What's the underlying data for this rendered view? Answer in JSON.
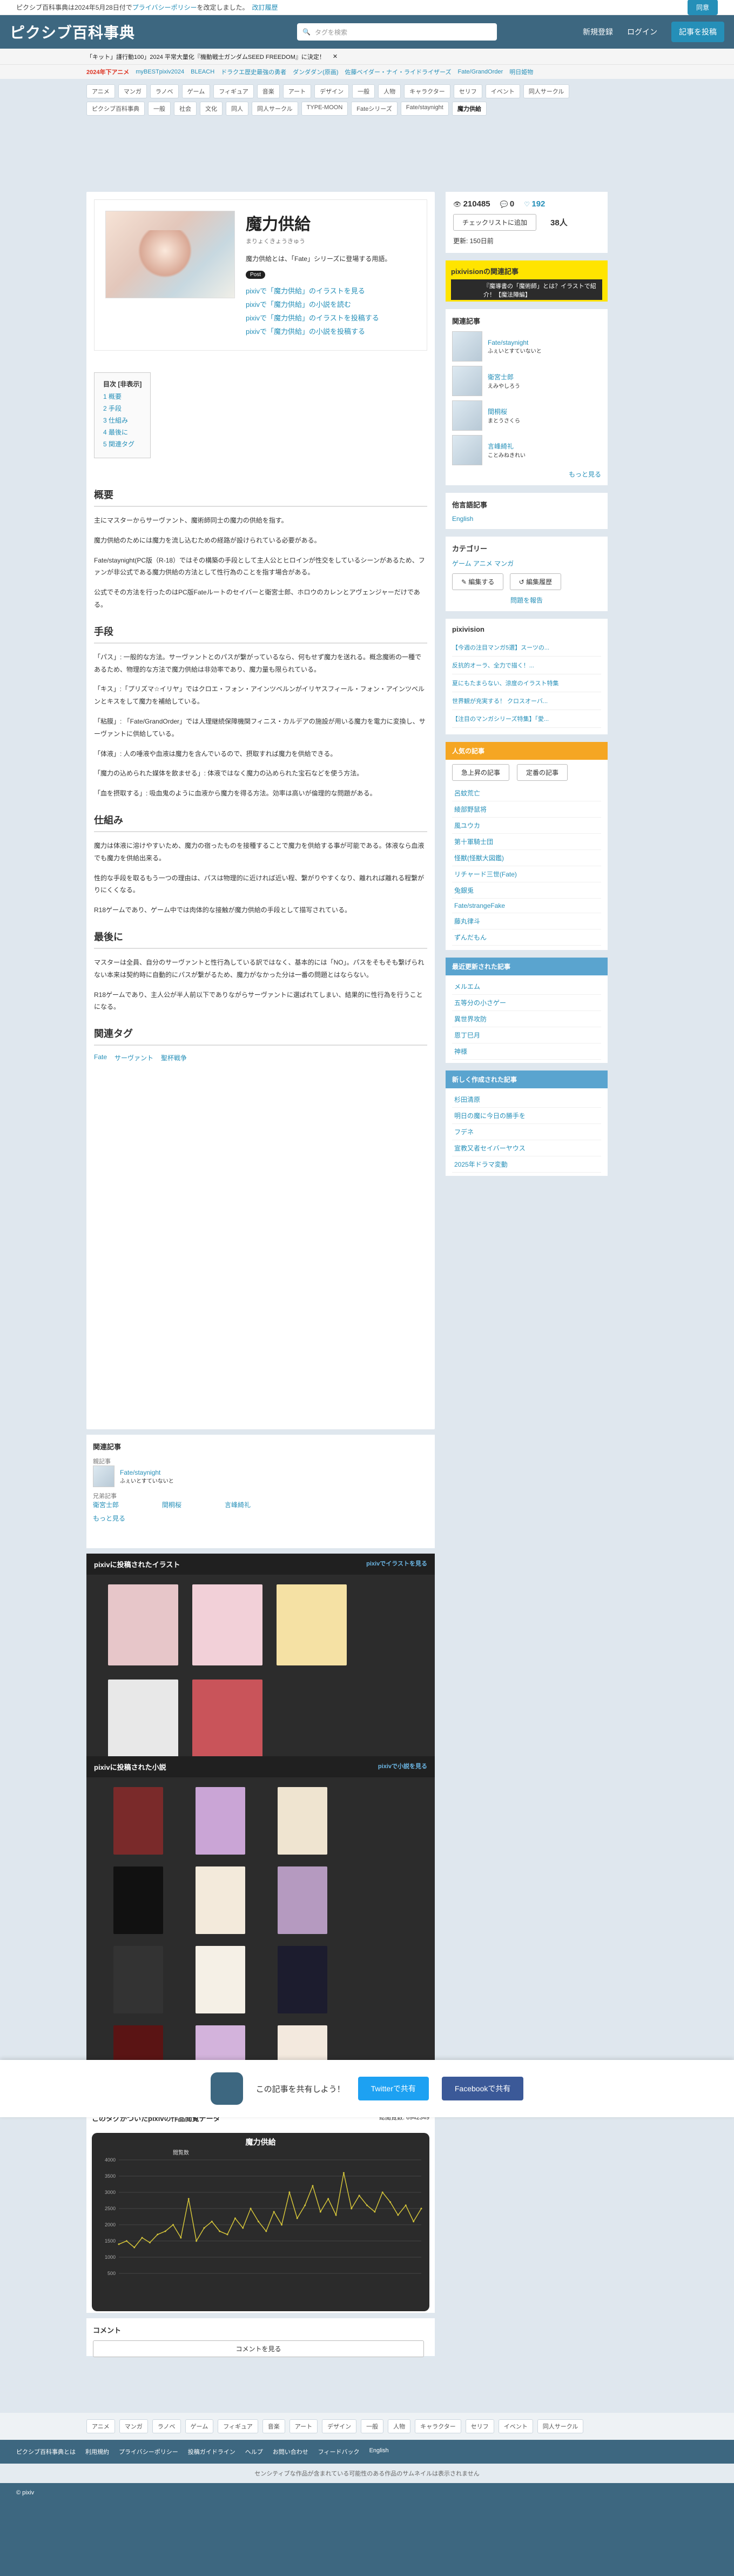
{
  "notice": {
    "text": "ピクシブ百科事典は2024年5月28日付で",
    "link": "プライバシーポリシー",
    "text2": "を改定しました。",
    "link2": "改訂履歴",
    "button": "同意"
  },
  "header": {
    "logo": "ピクシブ百科事典",
    "search_placeholder": "タグを検索",
    "new_register": "新規登録",
    "login": "ログイン",
    "write_button": "記事を投稿"
  },
  "trending": [
    "「キット」謹行動100」2024 平常大量化『機動戦士ガンダムSEED FREEDOM』に決定！"
  ],
  "trending2": {
    "label": "2024年下アニメ",
    "items": [
      "myBESTpixiv2024",
      "BLEACH",
      "ドラクエ歴史最強の勇者",
      "ダンダダン(原画)",
      "佐藤ベイダー・ナイ・ライドライザーズ",
      "Fate/GrandOrder",
      "明日姫物"
    ]
  },
  "cats1": [
    "アニメ",
    "マンガ",
    "ラノベ",
    "ゲーム",
    "フィギュア",
    "音楽",
    "アート",
    "デザイン",
    "一般",
    "人物",
    "キャラクター",
    "セリフ",
    "イベント",
    "同人サークル"
  ],
  "cats2": [
    "ピクシブ百科事典",
    "一般",
    "社会",
    "文化",
    "同人",
    "同人サークル",
    "TYPE-MOON",
    "Fateシリーズ",
    "Fate/staynight",
    "魔力供給"
  ],
  "article": {
    "title": "魔力供給",
    "reading": "まりょくきょうきゅう",
    "desc": "魔力供給とは、「Fate」シリーズに登場する用語。",
    "post": "Post",
    "links": [
      "pixivで「魔力供給」のイラストを見る",
      "pixivで「魔力供給」の小説を読む",
      "pixivで「魔力供給」のイラストを投稿する",
      "pixivで「魔力供給」の小説を投稿する"
    ],
    "toc_title": "目次 [非表示]",
    "toc": [
      "1 概要",
      "2 手段",
      "3 仕組み",
      "4 最後に",
      "5 関連タグ"
    ],
    "sections": [
      {
        "h": "概要",
        "p": [
          "主にマスターからサーヴァント、魔術師同士の魔力の供給を指す。",
          "魔力供給のためには魔力を流し込むための経路が設けられている必要がある。",
          "Fate/staynight(PC版（R-18）ではその構築の手段として主人公とヒロインが性交をしているシーンがあるため、ファンが非公式である魔力供給の方法として性行為のことを指す場合がある。",
          "公式でその方法を行ったのはPC版Fateルートのセイバーと衛宮士郎、ホロウのカレンとアヴェンジャーだけである。"
        ]
      },
      {
        "h": "手段",
        "p": [
          "「パス」: 一般的な方法。サーヴァントとのパスが繋がっているなら、何もせず魔力を送れる。概念魔術の一種であるため、物理的な方法で魔力供給は非効率であり、魔力量も限られている。",
          "「キス」:「プリズマ☆イリヤ」ではクロエ・フォン・アインツベルンがイリヤスフィール・フォン・アインツベルンとキスをして魔力を補給している。",
          "「粘膜」: 「Fate/GrandOrder」では人理継続保障機関フィニス・カルデアの施設が用いる魔力を電力に変換し、サーヴァントに供給している。",
          "「体液」: 人の唾液や血液は魔力を含んでいるので、摂取すれば魔力を供給できる。",
          "「魔力の込められた媒体を飲ませる」: 体液ではなく魔力の込められた宝石などを使う方法。",
          "「血を摂取する」: 吸血鬼のように血液から魔力を得る方法。効率は高いが倫理的な問題がある。"
        ]
      },
      {
        "h": "仕組み",
        "p": [
          "魔力は体液に溶けやすいため、魔力の宿ったものを接種することで魔力を供給する事が可能である。体液なら血液でも魔力を供給出来る。",
          "性的な手段を取るもう一つの理由は、パスは物理的に近ければ近い程、繋がりやすくなり、離れれば離れる程繋がりにくくなる。",
          "R18ゲームであり、ゲーム中では肉体的な接触が魔力供給の手段として描写されている。"
        ]
      },
      {
        "h": "最後に",
        "p": [
          "マスターは全員、自分のサーヴァントと性行為している訳ではなく、基本的には「NO」。パスをそもそも繋げられない本来は契約時に自動的にパスが繋がるため、魔力がなかった分は一番の問題とはならない。",
          "R18ゲームであり、主人公が半人前以下でありながらサーヴァントに選ばれてしまい、結果的に性行為を行うことになる。"
        ]
      }
    ],
    "related_title": "関連タグ",
    "related_tags": [
      "Fate",
      "サーヴァント",
      "聖杯戦争"
    ]
  },
  "side": {
    "views": "210485",
    "comments": "0",
    "likes": "192",
    "check_label": "チェックリストに追加",
    "check_count": "38人",
    "updated": "更新: 150日前",
    "pixivision": "pixivisionの関連記事",
    "pixivision_text": "『魔導書の「魔術師」とは？イラストで紹介！【魔法陣編】",
    "related_title": "関連記事",
    "related": [
      {
        "name": "Fate/staynight",
        "sub": "ふぇいとすていないと"
      },
      {
        "name": "衛宮士郎",
        "sub": "えみやしろう"
      },
      {
        "name": "間桐桜",
        "sub": "まとうさくら"
      },
      {
        "name": "言峰綺礼",
        "sub": "ことみねきれい"
      }
    ],
    "more": "もっと見る",
    "langs_title": "他言語記事",
    "lang": "English",
    "category_title": "カテゴリー",
    "categories": "ゲーム  アニメ  マンガ",
    "edit": "編集する",
    "history": "編集履歴",
    "report": "問題を報告",
    "pixivision2": "pixivision",
    "news": [
      "【今週の注目マンガ5選】スーツの...",
      "反抗的オーラ、全力で描く！...",
      "夏にもたまらない、涼度のイラスト特集",
      "世界観が充実する！ クロスオーバ...",
      "【注目のマンガシリーズ特集】「愛..."
    ],
    "ranking_title": "人気の記事",
    "rank_tabs": [
      "急上昇の記事",
      "定番の記事"
    ],
    "ranking": [
      "呂蚊荒亡",
      "綾部野鼠将",
      "風ユウカ",
      "第十軍騎士団",
      "怪獣(怪獣大図鑑)",
      "リチャード三世(Fate)",
      "兔銀兎",
      "Fate/strangeFake",
      "藤丸律斗",
      "ずんだもん"
    ],
    "recent_title": "最近更新された記事",
    "recent": [
      "メルエム",
      "五等分の小さゲー",
      "異世界攻防",
      "恩丁巳月",
      "神様"
    ],
    "new_title": "新しく作成された記事",
    "new_list": [
      "杉田清原",
      "明日の魔に今日の勝手を",
      "フデネ",
      "宣教又者セイバーヤウス",
      "2025年ドラマ変動"
    ]
  },
  "related_block": {
    "title": "関連記事",
    "parent_label": "親記事",
    "parent": "Fate/staynight",
    "parent_sub": "ふぇいとすていないと",
    "siblings_label": "兄弟記事",
    "siblings": [
      "衛宮士郎",
      "間桐桜",
      "言峰綺礼"
    ],
    "more": "もっと見る"
  },
  "illust": {
    "title": "pixivに投稿されたイラスト",
    "more": "pixivでイラストを見る"
  },
  "novel": {
    "title": "pixivに投稿された小説",
    "more": "pixivで小説を見る"
  },
  "share": {
    "text": "この記事を共有しよう！",
    "twitter": "Twitterで共有",
    "facebook": "Facebookで共有"
  },
  "chart_section": {
    "title": "このタグがついたpixivの作品閲覧データ",
    "total_label": "総閲覧数: 6942349",
    "chart_title": "魔力供給",
    "legend": "閲覧数"
  },
  "chart_data": {
    "type": "line",
    "title": "魔力供給",
    "series": [
      {
        "name": "閲覧数",
        "values": [
          1400,
          1500,
          1300,
          1600,
          1450,
          1700,
          1800,
          2000,
          1600,
          2800,
          1500,
          1900,
          2100,
          1800,
          1700,
          2200,
          1900,
          2500,
          2100,
          1800,
          2400,
          2000,
          3000,
          2200,
          2600,
          3200,
          2400,
          2800,
          2300,
          3600,
          2500,
          2900,
          2600,
          2400,
          3000,
          2700,
          2300,
          2600,
          2100,
          2500
        ]
      }
    ],
    "yticks": [
      "500",
      "1000",
      "1500",
      "2000",
      "2500",
      "3000",
      "3500",
      "4000"
    ],
    "ylim": [
      0,
      4000
    ]
  },
  "comment": {
    "title": "コメント",
    "button": "コメントを見る"
  },
  "footer": {
    "cats": [
      "アニメ",
      "マンガ",
      "ラノベ",
      "ゲーム",
      "フィギュア",
      "音楽",
      "アート",
      "デザイン",
      "一般",
      "人物",
      "キャラクター",
      "セリフ",
      "イベント",
      "同人サークル"
    ],
    "links": [
      "ピクシブ百科事典とは",
      "利用規約",
      "プライバシーポリシー",
      "投稿ガイドライン",
      "ヘルプ",
      "お問い合わせ",
      "フィードバック",
      "English"
    ],
    "sensitive": "センシティブな作品が含まれている可能性のある作品のサムネイルは表示されません",
    "copy": "© pixiv"
  }
}
